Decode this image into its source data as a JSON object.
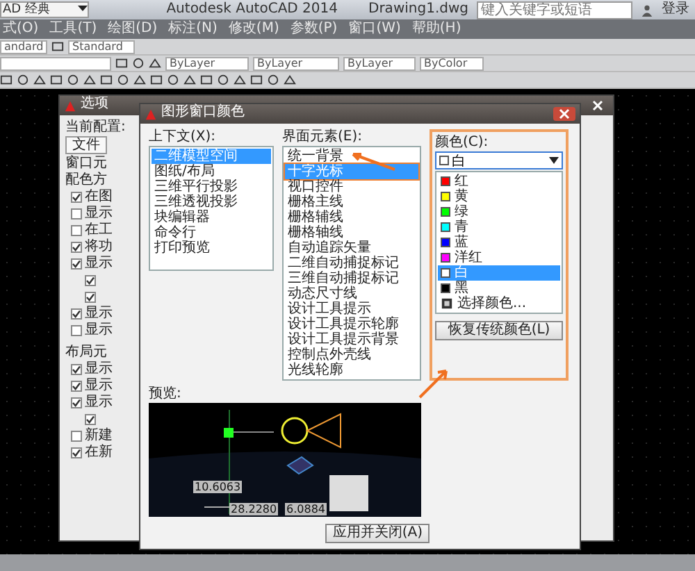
{
  "app_window": {
    "workspace": "AD 经典",
    "title": "Autodesk AutoCAD 2014",
    "document": "Drawing1.dwg",
    "search_placeholder": "键入关键字或短语",
    "sign_in": "登录"
  },
  "menu": [
    "式(O)",
    "工具(T)",
    "绘图(D)",
    "标注(N)",
    "修改(M)",
    "参数(P)",
    "窗口(W)",
    "帮助(H)"
  ],
  "toolbar": {
    "text_style": "andard",
    "dim_style": "Standard",
    "color_control": "ByLayer",
    "linetype": "ByLayer",
    "lineweight": "ByLayer",
    "plot_style": "ByColor"
  },
  "options_dialog": {
    "title": "选项",
    "profile_label": "当前配置:",
    "tab": "文件",
    "window_group": "窗口元",
    "scheme_label": "配色方",
    "window_checkboxes": [
      {
        "label": "在图",
        "checked": true
      },
      {
        "label": "显示",
        "checked": false
      },
      {
        "label": "在工",
        "checked": false
      },
      {
        "label": "将功",
        "checked": true
      },
      {
        "label": "显示",
        "checked": true,
        "children": [
          {
            "checked": true
          },
          {
            "checked": true
          }
        ]
      },
      {
        "label": "显示",
        "checked": true
      },
      {
        "label": "显示",
        "checked": false
      }
    ],
    "layout_group": "布局元",
    "layout_checkboxes": [
      {
        "label": "显示",
        "checked": true
      },
      {
        "label": "显示",
        "checked": true
      },
      {
        "label": "显示",
        "checked": true,
        "children": [
          {
            "checked": true
          }
        ]
      },
      {
        "label": "新建",
        "checked": false
      },
      {
        "label": "在新",
        "checked": true
      }
    ]
  },
  "color_dialog": {
    "title": "图形窗口颜色",
    "context_label": "上下文(X):",
    "contexts": [
      {
        "label": "二维模型空间",
        "selected": true
      },
      {
        "label": "图纸/布局",
        "selected": false
      },
      {
        "label": "三维平行投影",
        "selected": false
      },
      {
        "label": "三维透视投影",
        "selected": false
      },
      {
        "label": "块编辑器",
        "selected": false
      },
      {
        "label": "命令行",
        "selected": false
      },
      {
        "label": "打印预览",
        "selected": false
      }
    ],
    "elements_label": "界面元素(E):",
    "elements": [
      {
        "label": "统一背景",
        "selected": false
      },
      {
        "label": "十字光标",
        "selected": true
      },
      {
        "label": "视口控件",
        "selected": false
      },
      {
        "label": "栅格主线",
        "selected": false
      },
      {
        "label": "栅格辅线",
        "selected": false
      },
      {
        "label": "栅格轴线",
        "selected": false
      },
      {
        "label": "自动追踪矢量",
        "selected": false
      },
      {
        "label": "二维自动捕捉标记",
        "selected": false
      },
      {
        "label": "三维自动捕捉标记",
        "selected": false
      },
      {
        "label": "动态尺寸线",
        "selected": false
      },
      {
        "label": "设计工具提示",
        "selected": false
      },
      {
        "label": "设计工具提示轮廓",
        "selected": false
      },
      {
        "label": "设计工具提示背景",
        "selected": false
      },
      {
        "label": "控制点外壳线",
        "selected": false
      },
      {
        "label": "光线轮廓",
        "selected": false
      }
    ],
    "color_label": "颜色(C):",
    "color_value": {
      "label": "白",
      "color": "#ffffff"
    },
    "colors": [
      {
        "kind": "swatch",
        "label": "红",
        "color": "#ff0000",
        "selected": false
      },
      {
        "kind": "swatch",
        "label": "黄",
        "color": "#ffff00",
        "selected": false
      },
      {
        "kind": "swatch",
        "label": "绿",
        "color": "#00ff00",
        "selected": false
      },
      {
        "kind": "swatch",
        "label": "青",
        "color": "#00ffff",
        "selected": false
      },
      {
        "kind": "swatch",
        "label": "蓝",
        "color": "#0000ff",
        "selected": false
      },
      {
        "kind": "swatch",
        "label": "洋红",
        "color": "#ff00ff",
        "selected": false
      },
      {
        "kind": "swatch",
        "label": "白",
        "color": "#ffffff",
        "selected": true
      },
      {
        "kind": "swatch",
        "label": "黑",
        "color": "#000000",
        "selected": false
      },
      {
        "kind": "more",
        "label": "选择颜色...",
        "selected": false
      }
    ],
    "restore_button": "恢复传统颜色(L)",
    "preview_label": "预览:",
    "preview_dimensions": [
      "10.6063",
      "28.2280",
      "6.0884"
    ],
    "apply_button": "应用并关闭(A)"
  }
}
